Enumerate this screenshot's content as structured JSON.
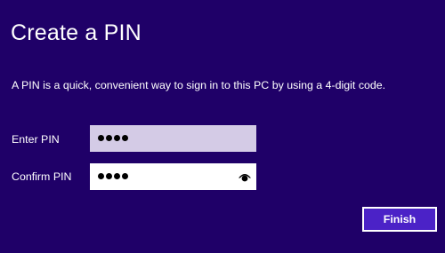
{
  "dialog": {
    "title": "Create a PIN",
    "description": "A PIN is a quick, convenient way to sign in to this PC by using a 4-digit code."
  },
  "fields": {
    "enter_pin": {
      "label": "Enter PIN",
      "masked_length": 4
    },
    "confirm_pin": {
      "label": "Confirm PIN",
      "masked_length": 4,
      "reveal_icon": "eye-icon"
    }
  },
  "actions": {
    "finish_label": "Finish"
  },
  "colors": {
    "background": "#1f0068",
    "button": "#4b22c7",
    "field_focused": "#d4cbe6",
    "field": "#ffffff"
  }
}
